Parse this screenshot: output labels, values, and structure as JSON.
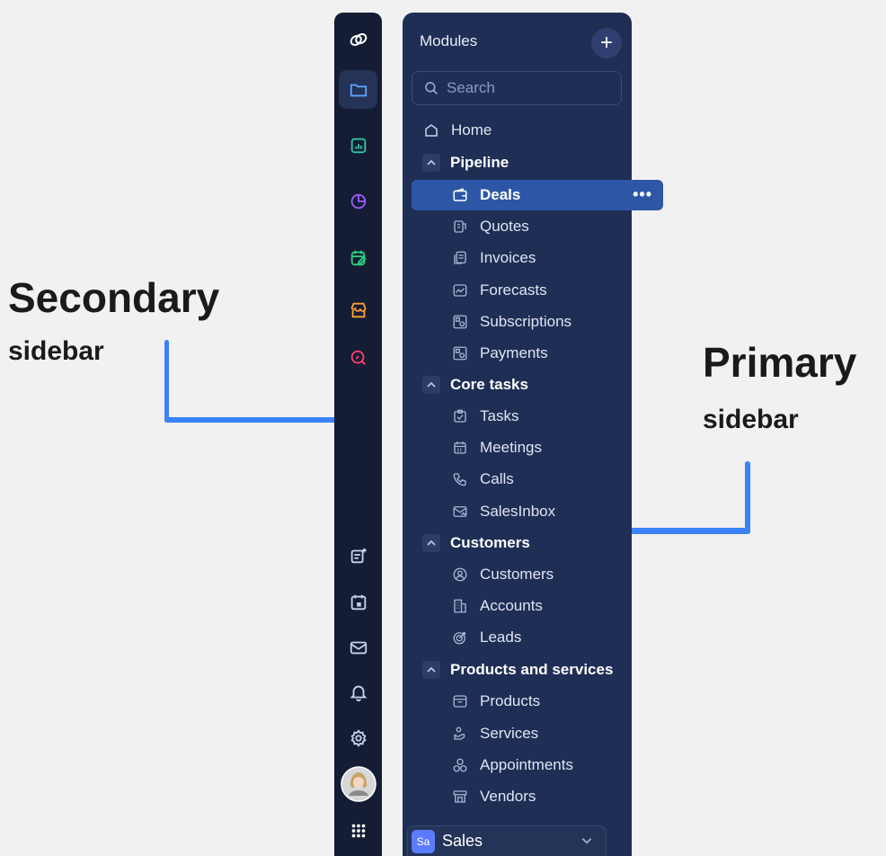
{
  "annotations": {
    "secondary_title": "Secondary",
    "secondary_sub": "sidebar",
    "primary_title": "Primary",
    "primary_sub": "sidebar",
    "line_color": "#3b82f6"
  },
  "rail": {
    "top_icons": [
      "brand-logo-icon",
      "folder-icon",
      "chart-icon",
      "pie-chart-icon",
      "calendar-edit-icon",
      "store-icon",
      "search-analytics-icon"
    ],
    "bottom_icons": [
      "add-note-icon",
      "calendar-icon",
      "mail-icon",
      "bell-icon",
      "gear-icon",
      "avatar",
      "apps-grid-icon"
    ],
    "active": "folder-icon"
  },
  "panel": {
    "title": "Modules",
    "add_label": "+",
    "search_placeholder": "Search",
    "home": "Home",
    "groups": [
      {
        "label": "Pipeline",
        "items": [
          {
            "label": "Deals",
            "icon": "wallet-icon",
            "active": true,
            "more": "•••"
          },
          {
            "label": "Quotes",
            "icon": "quote-icon"
          },
          {
            "label": "Invoices",
            "icon": "invoice-icon"
          },
          {
            "label": "Forecasts",
            "icon": "forecast-icon"
          },
          {
            "label": "Subscriptions",
            "icon": "subscription-icon"
          },
          {
            "label": "Payments",
            "icon": "payment-icon"
          }
        ]
      },
      {
        "label": "Core tasks",
        "items": [
          {
            "label": "Tasks",
            "icon": "task-icon"
          },
          {
            "label": "Meetings",
            "icon": "meeting-icon"
          },
          {
            "label": "Calls",
            "icon": "phone-icon"
          },
          {
            "label": "SalesInbox",
            "icon": "inbox-icon"
          }
        ]
      },
      {
        "label": "Customers",
        "items": [
          {
            "label": "Customers",
            "icon": "contact-icon"
          },
          {
            "label": "Accounts",
            "icon": "building-icon"
          },
          {
            "label": "Leads",
            "icon": "target-icon"
          }
        ]
      },
      {
        "label": "Products and services",
        "items": [
          {
            "label": "Products",
            "icon": "product-icon"
          },
          {
            "label": "Services",
            "icon": "service-icon"
          },
          {
            "label": "Appointments",
            "icon": "appointment-icon"
          },
          {
            "label": "Vendors",
            "icon": "vendor-icon"
          }
        ]
      }
    ],
    "footer": {
      "badge": "Sa",
      "label": "Sales"
    }
  }
}
